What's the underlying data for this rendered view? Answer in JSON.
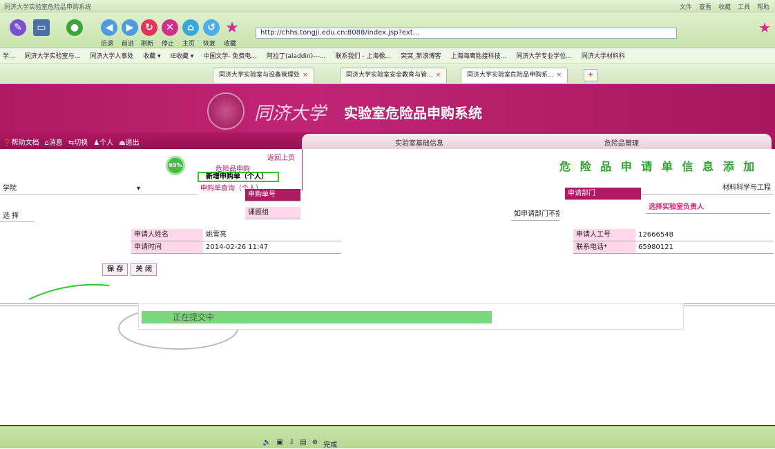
{
  "browser": {
    "window_title": "同济大学实验室危险品申购系统",
    "window_menu": [
      "文件",
      "查看",
      "收藏",
      "工具",
      "帮助"
    ],
    "toolbar_labels": [
      "后退",
      "前进",
      "刷新",
      "停止",
      "主页",
      "恢复",
      "收藏"
    ],
    "address": "http://chhs.tongji.edu.cn:8088/index.jsp?ext...",
    "favorites": [
      "学...",
      "同济大学实验室与...",
      "同济大学人事处",
      "收藏 ▾",
      "IE收藏 ▾",
      "中国文学- 免费电...",
      "阿拉丁(aladdin)---...",
      "联系我们 - 上海橡...",
      "突突_新浪博客",
      "上海海鹰粘接科技...",
      "同济大学专业学位...",
      "同济大学材料科"
    ],
    "tabs": [
      {
        "label": "同济大学实验室与设备管理处"
      },
      {
        "label": "同济大学实验室安全教育与管..."
      },
      {
        "label": "同济大学实验室危险品申购系..."
      }
    ],
    "tab_plus": "+",
    "status": "完成"
  },
  "banner": {
    "logo_text": "同济大学",
    "system_title": "实验室危险品申购系统"
  },
  "user_nav": [
    "帮助文档",
    "消息",
    "切换",
    "个人",
    "退出"
  ],
  "main_nav": [
    "实验室基础信息",
    "危险品管理"
  ],
  "left_panel": {
    "progress_badge": "65%",
    "dept_select": "学院",
    "row2": "选 择"
  },
  "side_menu": {
    "back": "返回上页",
    "group": "危险品申购",
    "new_order": "新增申购单（个人）",
    "query_order": "申购单查询（个人）"
  },
  "page_title": "危 险 品 申 请 单 信 息 添 加",
  "form": {
    "col_labels": [
      "申购单号",
      "课题组",
      "申请部门"
    ],
    "dept_value": "材料科学与工程",
    "dept_hint": "如申请部门不指",
    "lab_hint": "选择实验室负责人",
    "applicant_name_label": "申请人姓名",
    "applicant_name": "姚雪亮",
    "apply_time_label": "申请时间",
    "apply_time": "2014-02-26 11:47",
    "employee_no_label": "申请人工号",
    "employee_no": "12666548",
    "phone_label": "联系电话*",
    "phone": "65980121"
  },
  "buttons": {
    "save": "保 存",
    "close": "关 闭"
  },
  "progress": {
    "label": "正在提交中",
    "percent": 65
  },
  "colors": {
    "maroon": "#b01964",
    "pink": "#ffd6ea",
    "green": "#2ecc2e"
  }
}
